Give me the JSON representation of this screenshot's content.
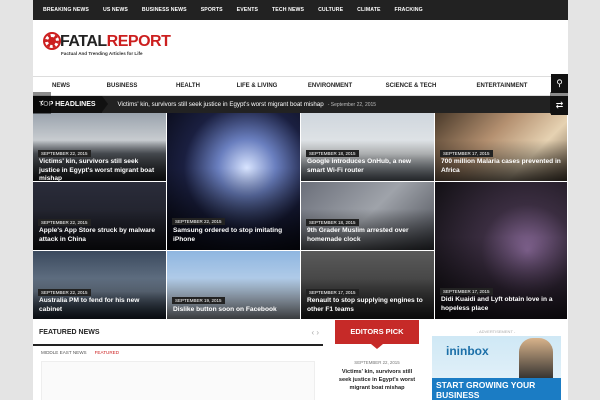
{
  "topnav": [
    "BREAKING NEWS",
    "US NEWS",
    "BUSINESS NEWS",
    "SPORTS",
    "EVENTS",
    "TECH NEWS",
    "CULTURE",
    "CLIMATE",
    "FRACKING"
  ],
  "logo": {
    "fatal": "FATAL",
    "report": "REPORT",
    "tagline": "Factual And Trending Articles for Life"
  },
  "mainnav": [
    "NEWS",
    "BUSINESS",
    "HEALTH",
    "LIFE & LIVING",
    "ENVIRONMENT",
    "SCIENCE & TECH",
    "ENTERTAINMENT"
  ],
  "icons": {
    "search": "search-icon",
    "shuffle": "shuffle-icon",
    "prev": "chevron-left-icon",
    "next": "chevron-right-icon"
  },
  "headlines": {
    "label": "TOP HEADLINES",
    "text": "Victims' kin, survivors still seek justice in Egypt's worst migrant boat mishap",
    "date": "- September 22, 2015"
  },
  "grid": [
    {
      "date": "SEPTEMBER 22, 2015",
      "title": "Victims' kin, survivors still seek justice in Egypt's worst migrant boat mishap"
    },
    {
      "date": "SEPTEMBER 22, 2015",
      "title": "Samsung ordered to stop imitating iPhone"
    },
    {
      "date": "SEPTEMBER 18, 2015",
      "title": "Google introduces OnHub, a new smart Wi-Fi router"
    },
    {
      "date": "SEPTEMBER 17, 2015",
      "title": "700 million Malaria cases prevented in Africa"
    },
    {
      "date": "SEPTEMBER 22, 2015",
      "title": "Apple's App Store struck by malware attack in China"
    },
    {
      "date": "SEPTEMBER 18, 2015",
      "title": "9th Grader Muslim arrested over homemade clock"
    },
    {
      "date": "SEPTEMBER 17, 2015",
      "title": "Didi Kuaidi and Lyft obtain love in a hopeless place"
    },
    {
      "date": "SEPTEMBER 22, 2015",
      "title": "Australia PM to fend for his new cabinet"
    },
    {
      "date": "SEPTEMBER 19, 2015",
      "title": "Dislike button soon on Facebook"
    },
    {
      "date": "SEPTEMBER 17, 2015",
      "title": "Renault to stop supplying engines to other F1 teams"
    }
  ],
  "featured": {
    "heading": "FEATURED NEWS",
    "tabs": [
      "MIDDLE EAST NEWS",
      "FEATURED"
    ]
  },
  "editors": {
    "heading": "EDITORS PICK",
    "date": "SEPTEMBER 22, 2015",
    "title": "Victims' kin, survivors still seek justice in Egypt's worst migrant boat mishap"
  },
  "ad": {
    "label": "- ADVERTISEMENT -",
    "brand": "inbox",
    "brand_prefix": "in",
    "tagline": "START GROWING YOUR BUSINESS"
  },
  "colors": {
    "accent": "#cc1f1f",
    "topbar": "#222222",
    "editors": "#c62a28"
  }
}
